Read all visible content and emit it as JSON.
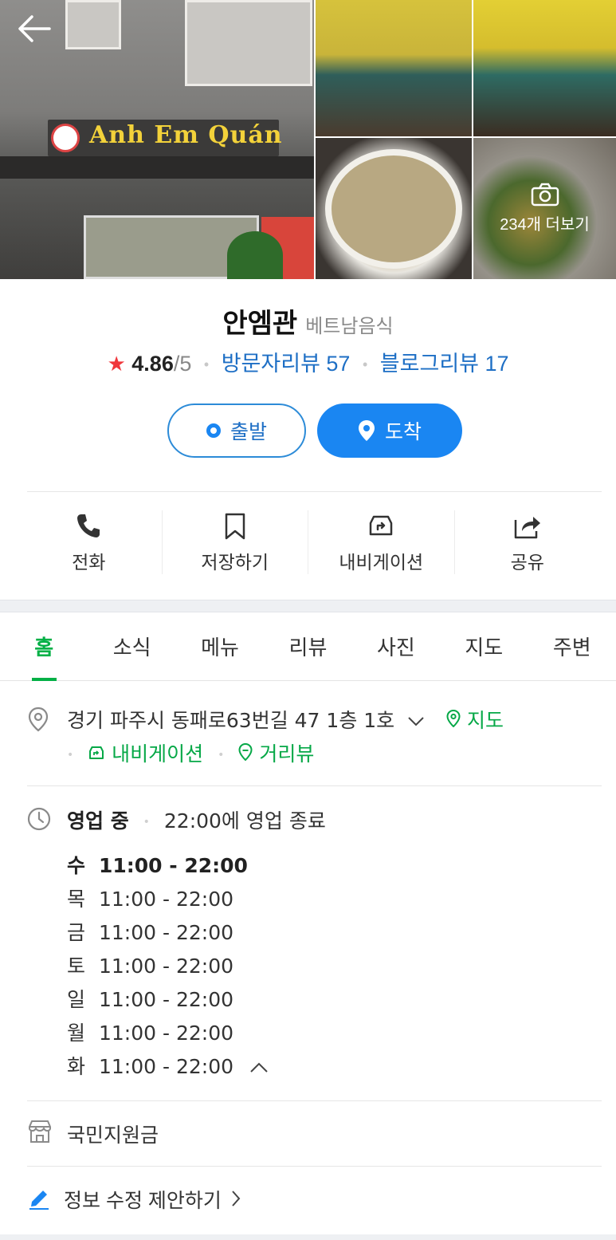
{
  "photos": {
    "more_label": "234개 더보기",
    "sign_text": "Anh Em Quán"
  },
  "place": {
    "name": "안엠관",
    "category": "베트남음식",
    "rating": "4.86",
    "rating_max": "/5",
    "visitor_reviews": "방문자리뷰 57",
    "blog_reviews": "블로그리뷰 17"
  },
  "route": {
    "start_label": "출발",
    "arrive_label": "도착"
  },
  "actions": [
    {
      "label": "전화",
      "icon": "phone-icon"
    },
    {
      "label": "저장하기",
      "icon": "bookmark-icon"
    },
    {
      "label": "내비게이션",
      "icon": "navigation-icon"
    },
    {
      "label": "공유",
      "icon": "share-icon"
    }
  ],
  "tabs": [
    "홈",
    "소식",
    "메뉴",
    "리뷰",
    "사진",
    "지도",
    "주변"
  ],
  "address": {
    "text": "경기 파주시 동패로63번길 47 1층 1호",
    "map_label": "지도",
    "navi_label": "내비게이션",
    "street_view_label": "거리뷰"
  },
  "hours": {
    "status": "영업 중",
    "close_info": "22:00에 영업 종료",
    "days": [
      {
        "day": "수",
        "time": "11:00 - 22:00"
      },
      {
        "day": "목",
        "time": "11:00 - 22:00"
      },
      {
        "day": "금",
        "time": "11:00 - 22:00"
      },
      {
        "day": "토",
        "time": "11:00 - 22:00"
      },
      {
        "day": "일",
        "time": "11:00 - 22:00"
      },
      {
        "day": "월",
        "time": "11:00 - 22:00"
      },
      {
        "day": "화",
        "time": "11:00 - 22:00"
      }
    ]
  },
  "feature": "국민지원금",
  "suggest_edit": "정보 수정 제안하기",
  "colors": {
    "accent_green": "#03b046",
    "link_blue": "#1e6fc5",
    "primary_blue": "#1a86f2",
    "star_red": "#f0373c"
  }
}
